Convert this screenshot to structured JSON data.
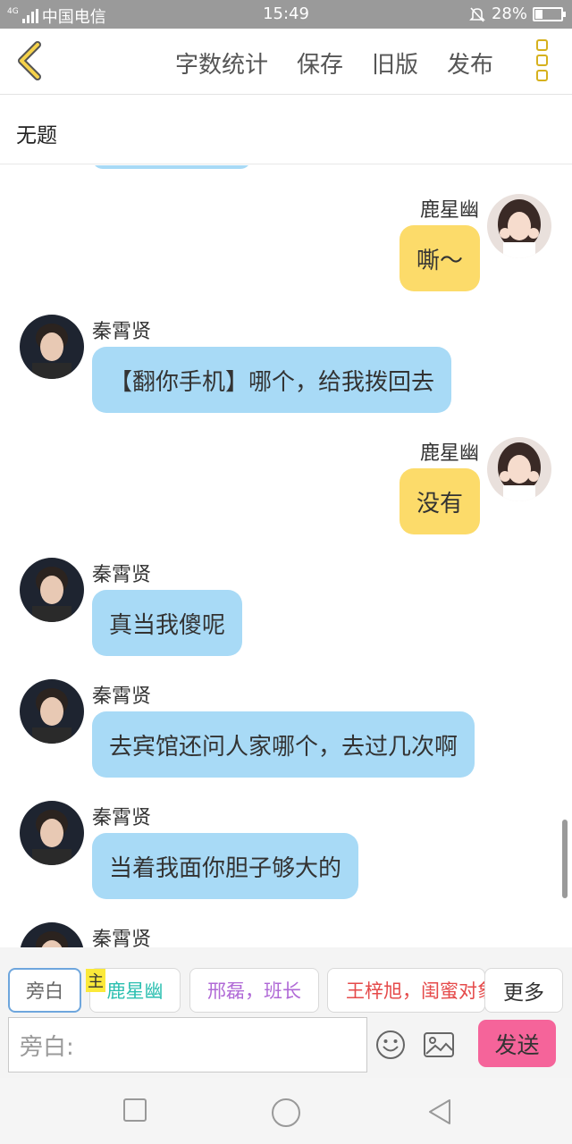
{
  "status_bar": {
    "network": "4G",
    "carrier": "中国电信",
    "time": "15:49",
    "battery_text": "28%",
    "battery_level": 0.28,
    "icons": [
      "signal-icon",
      "mute-bell-icon",
      "battery-icon"
    ]
  },
  "header": {
    "back_icon": "chevron-left-icon",
    "menu": [
      "字数统计",
      "保存",
      "旧版",
      "发布"
    ],
    "more_icon": "more-dots-icon",
    "accent_color": "#d6b11e"
  },
  "title": "无题",
  "messages": [
    {
      "side": "right",
      "name": "鹿星幽",
      "text": "嘶～",
      "color": "#fcdb6a"
    },
    {
      "side": "left",
      "name": "秦霄贤",
      "text": "【翻你手机】哪个，给我拨回去",
      "color": "#a8daf6"
    },
    {
      "side": "right",
      "name": "鹿星幽",
      "text": "没有",
      "color": "#fcdb6a"
    },
    {
      "side": "left",
      "name": "秦霄贤",
      "text": "真当我傻呢",
      "color": "#a8daf6"
    },
    {
      "side": "left",
      "name": "秦霄贤",
      "text": "去宾馆还问人家哪个，去过几次啊",
      "color": "#a8daf6"
    },
    {
      "side": "left",
      "name": "秦霄贤",
      "text": "当着我面你胆子够大的",
      "color": "#a8daf6"
    },
    {
      "side": "left",
      "name": "秦霄贤",
      "text": "",
      "color": "#a8daf6"
    }
  ],
  "characters": {
    "narration": "旁白",
    "host_tag": "主",
    "chips": [
      {
        "label": "鹿星幽",
        "color": "#2bbfb0"
      },
      {
        "label": "邢磊，班长",
        "color": "#b069d6"
      },
      {
        "label": "王梓旭，闺蜜对象",
        "color": "#e54a4a"
      }
    ],
    "more": "更多"
  },
  "composer": {
    "placeholder": "旁白:",
    "emoji_icon": "emoji-icon",
    "image_icon": "image-icon",
    "send": "发送",
    "send_color": "#f5649a"
  },
  "nav": [
    "square-recent-icon",
    "circle-home-icon",
    "triangle-back-icon"
  ]
}
